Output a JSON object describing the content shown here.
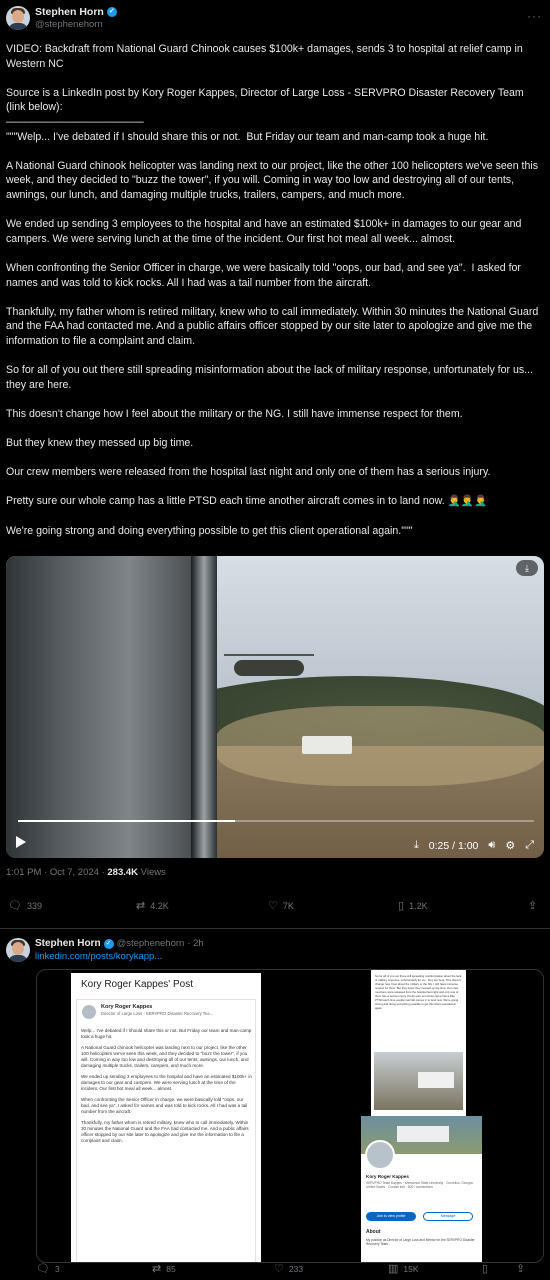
{
  "tweet1": {
    "display_name": "Stephen Horn",
    "handle": "@stephenehorn",
    "paragraphs": [
      "VIDEO: Backdraft from National Guard Chinook causes $100k+ damages, sends 3 to hospital at relief camp in Western NC",
      "Source is a LinkedIn post by Kory Roger Kappes, Director of Large Loss - SERVPRO Disaster Recovery Team (link below):\n—————————————\n\"\"\"Welp... I've debated if I should share this or not.  But Friday our team and man-camp took a huge hit.",
      "A National Guard chinook helicopter was landing next to our project, like the other 100 helicopters we've seen this week, and they decided to \"buzz the tower\", if you will. Coming in way too low and destroying all of our tents, awnings, our lunch, and damaging multiple trucks, trailers, campers, and much more.",
      "We ended up sending 3 employees to the hospital and have an estimated $100k+ in damages to our gear and campers. We were serving lunch at the time of the incident. Our first hot meal all week... almost.",
      "When confronting the Senior Officer in charge, we were basically told \"oops, our bad, and see ya\".  I asked for names and was told to kick rocks. All I had was a tail number from the aircraft.",
      "Thankfully, my father whom is retired military, knew who to call immediately. Within 30 minutes the National Guard and the FAA had contacted me. And a public affairs officer stopped by our site later to apologize and give me the information to file a complaint and claim.",
      "So for all of you out there still spreading misinformation about the lack of military response, unfortunately for us... they are here.",
      "This doesn't change how I feel about the military or the NG. I still have immense respect for them.",
      "But they knew they messed up big time.",
      "Our crew members were released from the hospital last night and only one of them has a serious injury.",
      "Pretty sure our whole camp has a little PTSD each time another aircraft comes in to land now. 🤦‍♂️🤦‍♂️🤦‍♂️",
      "We're going strong and doing everything possible to get this client operational again.\"\"\""
    ],
    "video": {
      "time": "0:25 / 1:00",
      "progress": 0.42
    },
    "timestamp": "1:01 PM · Oct 7, 2024 · ",
    "views_count": "283.4K",
    "views_label": " Views",
    "replies": "339",
    "reposts": "4.2K",
    "likes": "7K",
    "bookmarks": "1.2K"
  },
  "tweet2": {
    "display_name": "Stephen Horn",
    "handle": "@stephenehorn",
    "age": "· 2h",
    "link": "linkedin.com/posts/korykapp...",
    "embed": {
      "post_title": "Kory Roger Kappes' Post",
      "author": "Kory Roger Kappes",
      "author_sub": "Director of Large Loss - SERVPRO Disaster Recovery Tea...",
      "post_paragraphs": [
        "Welp... I've debated if I should share this or not.  But Friday our team and man-camp took a huge hit.",
        "A National Guard chinook helicopter was landing next to our project, like the other 100 helicopters we've seen this week, and they decided to \"buzz the tower\", if you will. Coming in way too low and destroying all of our tents, awnings, our lunch, and damaging multiple trucks, trailers, campers, and much more.",
        "We ended up sending 3 employees to the hospital and have an estimated $100k+ in damages to our gear and campers. We were serving lunch at the time of the incident. Our first hot meal all week... almost.",
        "When confronting the Senior Officer in charge, we were basically told \"oops, our bad, and see ya\". I asked for names and was told to kick rocks. All I had was a tail number from the aircraft.",
        "Thankfully, my father whom is retired military, knew who to call immediately. Within 30 minutes the National Guard and the FAA had contacted me. And a public affairs officer stopped by our site later to apologize and give me the information to file a complaint and claim."
      ],
      "mini_text": "So for all of you out there still spreading misinformation about the lack of military response, unfortunately for us... they are here. This doesn't change how I feel about the military or the NG. I still have immense respect for them. But they knew they messed up big time. Our crew members were released from the hospital last night and only one of them has a serious injury. Pretty sure our whole camp has a little PTSD each time another aircraft comes in to land now. We're going strong and doing everything possible to get this client operational again.",
      "profile_name": "Kory Roger Kappes",
      "profile_sub": "SERVPRO Team Kappes · Weetamoe State University · Cornelius, Georgia, United States · Contact info · 500+ connections",
      "profile_btn_primary": "Join to view profile",
      "profile_btn_secondary": "Message",
      "about_heading": "About",
      "about_text": "My position as Director of Large Loss and Mentor for the SERVPRO Disaster Recovery Team..."
    },
    "replies": "3",
    "reposts": "85",
    "likes": "233",
    "views": "15K"
  },
  "colors": {
    "background": "#000000",
    "text": "#e7e9ea",
    "muted": "#71767b",
    "accent": "#1d9bf0",
    "linkedin": "#0a66c2"
  },
  "icons": [
    "verified-badge-icon",
    "more-icon",
    "download-icon",
    "play-icon",
    "volume-icon",
    "settings-icon",
    "fullscreen-icon",
    "reply-icon",
    "repost-icon",
    "like-icon",
    "bookmark-icon",
    "share-icon",
    "views-icon"
  ]
}
